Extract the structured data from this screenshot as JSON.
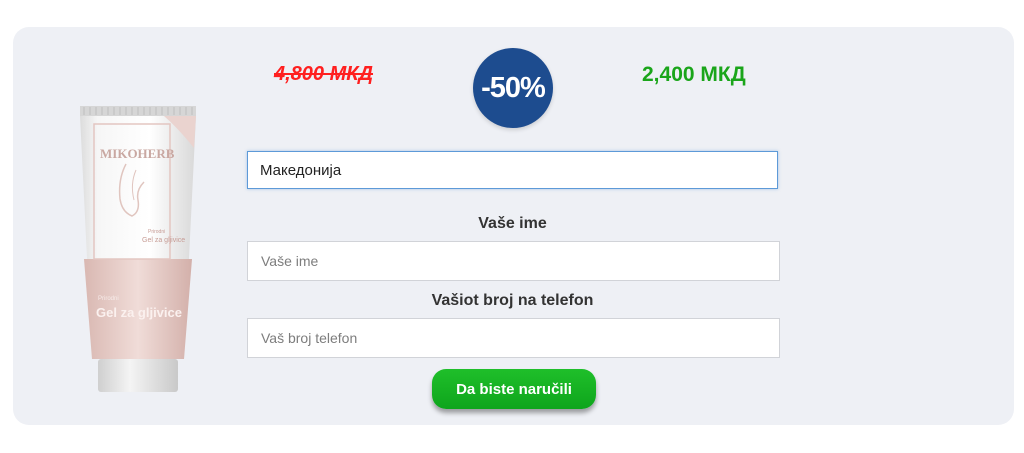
{
  "pricing": {
    "old_price": "4,800 МКД",
    "discount": "-50%",
    "new_price": "2,400 МКД"
  },
  "product": {
    "brand": "MIKOHERB",
    "subtitle_small": "Prirodni",
    "subtitle": "Gel za gljivice",
    "label_large_small": "Prirodni",
    "label_large": "Gel za gljivice"
  },
  "form": {
    "country_value": "Македонија",
    "name_label": "Vaše ime",
    "name_placeholder": "Vaše ime",
    "phone_label": "Vašiot broj na telefon",
    "phone_placeholder": "Vaš broj telefon",
    "submit_label": "Da biste naručili"
  },
  "colors": {
    "panel_bg": "#eef0f5",
    "old_price": "#ff1f1f",
    "new_price": "#1aa51a",
    "badge": "#1d4c8f",
    "button": "#12ad1f"
  }
}
